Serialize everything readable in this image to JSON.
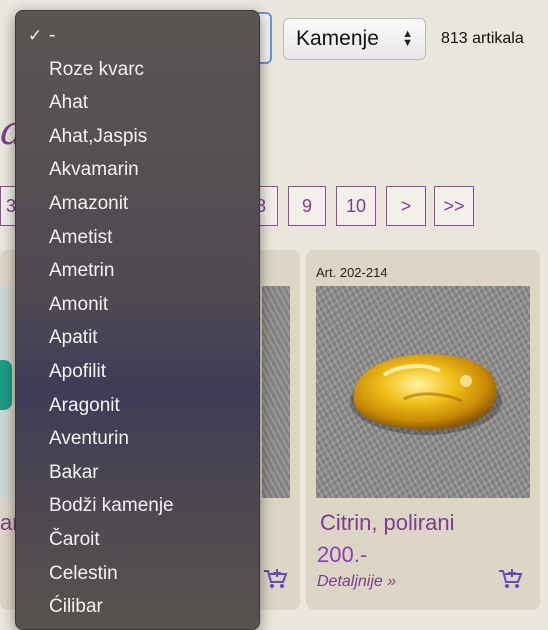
{
  "category_select": {
    "selected": "-",
    "options": [
      "-",
      "Roze kvarc",
      "Ahat",
      "Ahat,Jaspis",
      "Akvamarin",
      "Amazonit",
      "Ametist",
      "Ametrin",
      "Amonit",
      "Apatit",
      "Apofilit",
      "Aragonit",
      "Aventurin",
      "Bakar",
      "Bodži kamenje",
      "Čaroit",
      "Celestin",
      "Ćilibar"
    ]
  },
  "type_select": {
    "value": "Kamenje"
  },
  "count_text": "813 artikala",
  "heading_fragment": "a",
  "pagination": [
    {
      "label": "3"
    },
    {
      "label": "8"
    },
    {
      "label": "9"
    },
    {
      "label": "10"
    },
    {
      "label": ">"
    },
    {
      "label": ">>"
    }
  ],
  "products": [
    {
      "name_fragment": "ar",
      "cart_icon": "cart-icon"
    },
    {
      "article": "Art. 202-214",
      "name": "Citrin, polirani",
      "price": "200.-",
      "detail_link": "Detaljnije »",
      "cart_icon": "cart-icon"
    }
  ],
  "colors": {
    "accent": "#7d3d8e",
    "price": "#8e3fb1",
    "background": "#ece7dc",
    "card": "#ddd6c7"
  }
}
